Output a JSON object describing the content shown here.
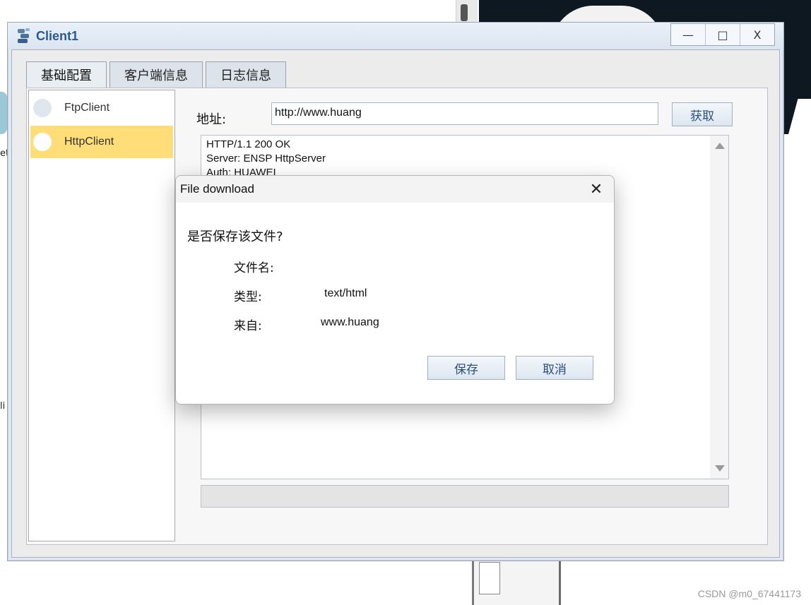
{
  "window": {
    "title": "Client1",
    "controls": {
      "minimize": "—",
      "maximize": "□",
      "close": "X"
    }
  },
  "tabs": [
    "基础配置",
    "客户端信息",
    "日志信息"
  ],
  "active_tab": "基础配置",
  "side_list": [
    "FtpClient",
    "HttpClient"
  ],
  "selected_side_item": "HttpClient",
  "address": {
    "label": "地址:",
    "value": "http://www.huang",
    "button": "获取"
  },
  "response_lines": [
    "HTTP/1.1 200 OK",
    "Server: ENSP HttpServer",
    "Auth: HUAWEI"
  ],
  "dialog": {
    "title": "File download",
    "close": "✕",
    "question": "是否保存该文件?",
    "filename_label": "文件名:",
    "filename_value": "",
    "type_label": "类型:",
    "type_value": "text/html",
    "from_label": "来自:",
    "from_value": "www.huang",
    "save_button": "保存",
    "cancel_button": "取消"
  },
  "watermark": "CSDN @m0_67441173",
  "left_edge": {
    "label1": "et",
    "label2": "li"
  }
}
